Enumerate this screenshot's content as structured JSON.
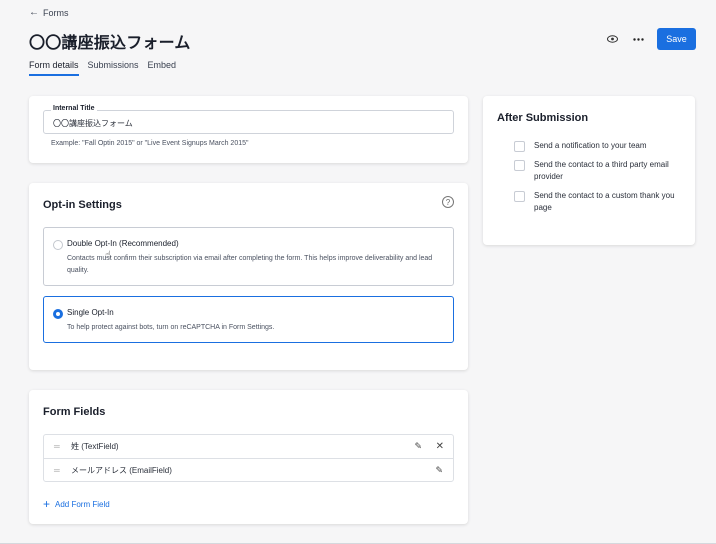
{
  "header": {
    "back_label": "Forms",
    "title": "〇〇講座振込フォーム",
    "save_label": "Save"
  },
  "tabs": [
    {
      "label": "Form details",
      "active": true
    },
    {
      "label": "Submissions",
      "active": false
    },
    {
      "label": "Embed",
      "active": false
    }
  ],
  "internal_title": {
    "legend": "Internal Title",
    "value": "〇〇講座振込フォーム",
    "hint": "Example: \"Fall Optin 2015\" or \"Live Event Signups March 2015\""
  },
  "optin": {
    "title": "Opt-in Settings",
    "options": [
      {
        "label": "Double Opt-In (Recommended)",
        "description": "Contacts must confirm their subscription via email after completing the form. This helps improve deliverability and lead quality.",
        "selected": false
      },
      {
        "label": "Single Opt-In",
        "description": "To help protect against bots, turn on reCAPTCHA in Form Settings.",
        "selected": true
      }
    ]
  },
  "form_fields": {
    "title": "Form Fields",
    "fields": [
      {
        "name": "姓 (TextField)",
        "deletable": true
      },
      {
        "name": "メールアドレス (EmailField)",
        "deletable": false
      }
    ],
    "add_label": "Add Form Field"
  },
  "after_submission": {
    "title": "After Submission",
    "items": [
      {
        "label": "Send a notification to your team",
        "checked": false
      },
      {
        "label": "Send the contact to a third party email provider",
        "checked": false
      },
      {
        "label": "Send the contact to a custom thank you page",
        "checked": false
      }
    ]
  },
  "colors": {
    "accent": "#1a6fe0",
    "background": "#f6f6f7"
  }
}
